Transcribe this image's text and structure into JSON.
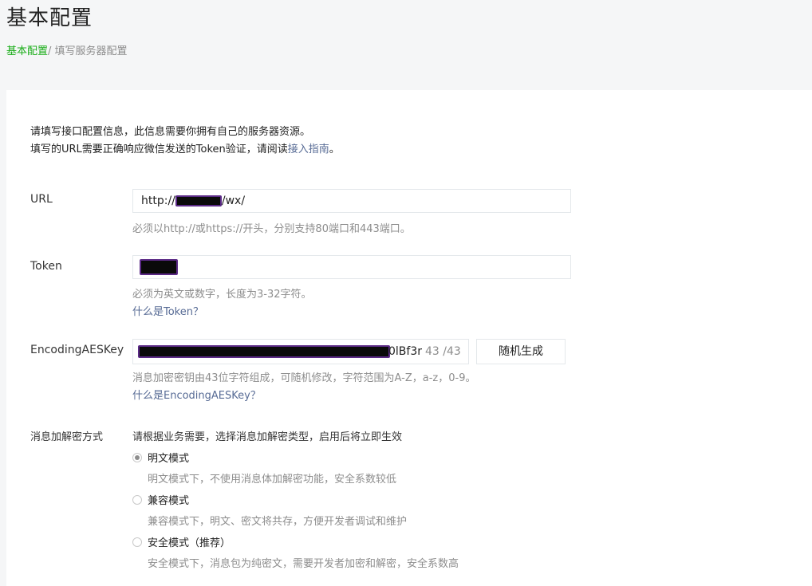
{
  "page": {
    "title": "基本配置",
    "breadcrumb": {
      "parent": "基本配置",
      "separator": "/ ",
      "current": "填写服务器配置"
    }
  },
  "intro": {
    "line1": "请填写接口配置信息，此信息需要你拥有自己的服务器资源。",
    "line2_prefix": "填写的URL需要正确响应微信发送的Token验证，请阅读",
    "line2_link": "接入指南",
    "line2_suffix": "。"
  },
  "url_field": {
    "label": "URL",
    "value_prefix": "http://",
    "value_suffix": "/wx/",
    "hint": "必须以http://或https://开头，分别支持80端口和443端口。"
  },
  "token_field": {
    "label": "Token",
    "hint": "必须为英文或数字，长度为3-32字符。",
    "help_link": "什么是Token？"
  },
  "aes_field": {
    "label": "EncodingAESKey",
    "visible_tail": "0lBf3r",
    "counter": "43 /43",
    "generate_button": "随机生成",
    "hint": "消息加密密钥由43位字符组成，可随机修改，字符范围为A-Z，a-z，0-9。",
    "help_link": "什么是EncodingAESKey？"
  },
  "encryption": {
    "label": "消息加解密方式",
    "description": "请根据业务需要，选择消息加解密类型，启用后将立即生效",
    "options": [
      {
        "label": "明文模式",
        "desc": "明文模式下，不使用消息体加解密功能，安全系数较低",
        "checked": true
      },
      {
        "label": "兼容模式",
        "desc": "兼容模式下，明文、密文将共存，方便开发者调试和维护",
        "checked": false
      },
      {
        "label": "安全模式（推荐）",
        "desc": "安全模式下，消息包为纯密文，需要开发者加密和解密，安全系数高",
        "checked": false
      }
    ]
  },
  "colors": {
    "accent": "#1aad19",
    "link": "#576b95",
    "hint": "#8d8d8d",
    "redaction_border": "#5b2a86"
  }
}
